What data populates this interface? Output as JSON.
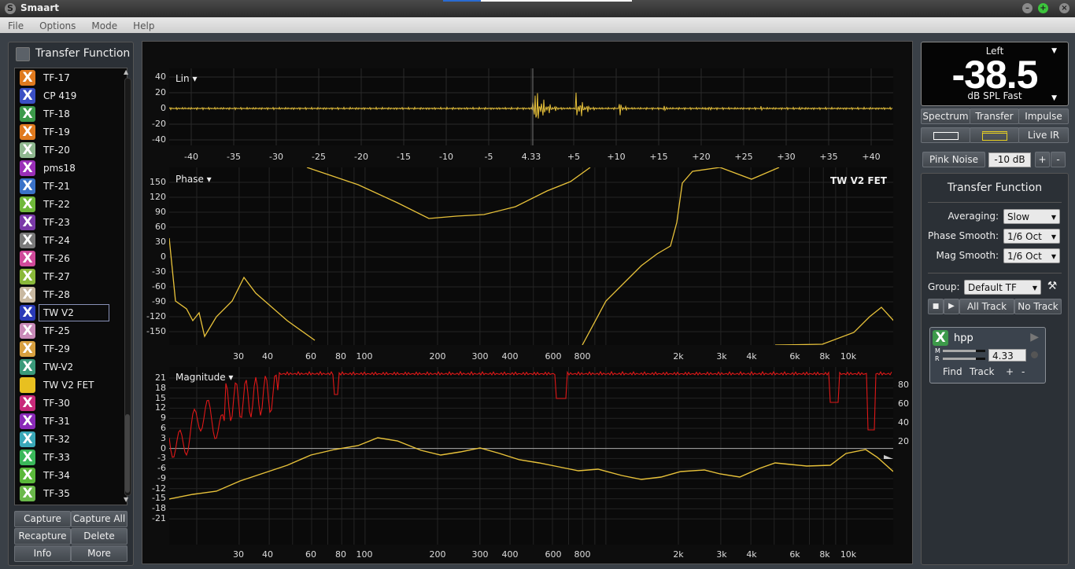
{
  "app": {
    "title": "Smaart",
    "title_progress": 0.2
  },
  "menu": [
    "File",
    "Options",
    "Mode",
    "Help"
  ],
  "left_panel": {
    "title": "Transfer Function",
    "items": [
      {
        "label": "TF-17",
        "color": "#e07a1e"
      },
      {
        "label": "CP 419",
        "color": "#3a4fc4"
      },
      {
        "label": "TF-18",
        "color": "#3c9a4a"
      },
      {
        "label": "TF-19",
        "color": "#e07a1e"
      },
      {
        "label": "TF-20",
        "color": "#8fb88f"
      },
      {
        "label": "pms18",
        "color": "#9a2fb8"
      },
      {
        "label": "TF-21",
        "color": "#3a72c8"
      },
      {
        "label": "TF-22",
        "color": "#6fb83a"
      },
      {
        "label": "TF-23",
        "color": "#7a3aa8"
      },
      {
        "label": "TF-24",
        "color": "#7a7a7a"
      },
      {
        "label": "TF-26",
        "color": "#d04a9a"
      },
      {
        "label": "TF-27",
        "color": "#8ab83a"
      },
      {
        "label": "TF-28",
        "color": "#c8b8a0"
      },
      {
        "label": "TW V2",
        "color": "#2a3ab8",
        "selected": true
      },
      {
        "label": "TF-25",
        "color": "#c88ab8"
      },
      {
        "label": "TF-29",
        "color": "#d8a040"
      },
      {
        "label": "TW-V2",
        "color": "#3a9a7a"
      },
      {
        "label": "TW V2 FET",
        "color": "#e8c020",
        "nox": true
      },
      {
        "label": "TF-30",
        "color": "#c82a7a"
      },
      {
        "label": "TF-31",
        "color": "#8a2ab8"
      },
      {
        "label": "TF-32",
        "color": "#3aa8b8"
      },
      {
        "label": "TF-33",
        "color": "#3ab85a"
      },
      {
        "label": "TF-34",
        "color": "#5ab83a"
      },
      {
        "label": "TF-35",
        "color": "#6ab84a"
      }
    ],
    "x_glyph": "X",
    "buttons": [
      "Capture",
      "Capture All",
      "Recapture",
      "Delete",
      "Info",
      "More"
    ]
  },
  "impulse": {
    "label": "Lin ▾",
    "y_ticks": [
      "40",
      "20",
      "0",
      "-20",
      "-40"
    ],
    "x_ticks": [
      "-40",
      "-35",
      "-30",
      "-25",
      "-20",
      "-15",
      "-10",
      "-5",
      "4.33",
      "+5",
      "+10",
      "+15",
      "+20",
      "+25",
      "+30",
      "+35",
      "+40"
    ],
    "trace_color": "#e8c23a"
  },
  "phase": {
    "label": "Phase ▾",
    "trace_name": "TW V2 FET",
    "y_ticks": [
      "150",
      "120",
      "90",
      "60",
      "30",
      "0",
      "-30",
      "-60",
      "-90",
      "-120",
      "-150"
    ],
    "x_ticks": [
      "30",
      "40",
      "60",
      "80",
      "100",
      "200",
      "300",
      "400",
      "600",
      "800",
      "2k",
      "3k",
      "4k",
      "6k",
      "8k",
      "10k"
    ]
  },
  "magnitude": {
    "label": "Magnitude ▾",
    "y_ticks": [
      "21",
      "18",
      "15",
      "12",
      "9",
      "6",
      "3",
      "0",
      "-3",
      "-6",
      "-9",
      "-12",
      "-15",
      "-18",
      "-21"
    ],
    "coh_ticks": [
      "80",
      "60",
      "40",
      "20"
    ],
    "x_ticks": [
      "30",
      "40",
      "60",
      "80",
      "100",
      "200",
      "300",
      "400",
      "600",
      "800",
      "2k",
      "3k",
      "4k",
      "6k",
      "8k",
      "10k"
    ],
    "mag_color": "#e8c23a",
    "coh_color": "#e01818"
  },
  "meter": {
    "channel": "Left",
    "value": "-38.5",
    "unit": "dB SPL Fast"
  },
  "mode_tabs": [
    "Spectrum",
    "Transfer",
    "Impulse"
  ],
  "live_ir": "Live IR",
  "generator": {
    "label": "Pink Noise",
    "level": "-10 dB",
    "plus": "+",
    "minus": "-"
  },
  "tf_panel": {
    "title": "Transfer Function",
    "averaging_label": "Averaging:",
    "averaging_value": "Slow",
    "phase_smooth_label": "Phase Smooth:",
    "phase_smooth_value": "1/6 Oct",
    "mag_smooth_label": "Mag Smooth:",
    "mag_smooth_value": "1/6 Oct",
    "group_label": "Group:",
    "group_value": "Default TF",
    "all_track": "All Track",
    "no_track": "No Track",
    "track": {
      "name": "hpp",
      "m": "M",
      "r": "R",
      "delay": "4.33",
      "find": "Find",
      "track": "Track",
      "plus": "+",
      "minus": "-"
    }
  }
}
